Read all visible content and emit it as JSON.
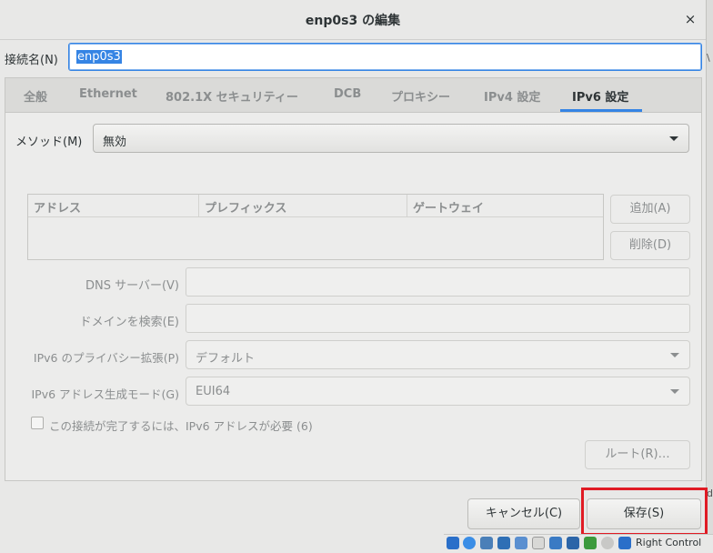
{
  "window": {
    "title": "enp0s3 の編集",
    "close_glyph": "×"
  },
  "connection_name": {
    "label": "接続名(N)",
    "value": "enp0s3"
  },
  "tabs": [
    "全般",
    "Ethernet",
    "802.1X セキュリティー",
    "DCB",
    "プロキシー",
    "IPv4 設定",
    "IPv6 設定"
  ],
  "active_tab": "IPv6 設定",
  "method": {
    "label": "メソッド(M)",
    "value": "無効"
  },
  "address_table": {
    "headers": [
      "アドレス",
      "プレフィックス",
      "ゲートウェイ"
    ],
    "rows": []
  },
  "buttons": {
    "add": "追加(A)",
    "delete": "削除(D)",
    "routes": "ルート(R)…",
    "cancel": "キャンセル(C)",
    "save": "保存(S)"
  },
  "dns": {
    "label": "DNS サーバー(V)",
    "value": ""
  },
  "search_domains": {
    "label": "ドメインを検索(E)",
    "value": ""
  },
  "privacy": {
    "label": "IPv6 のプライバシー拡張(P)",
    "value": "デフォルト"
  },
  "addr_gen": {
    "label": "IPv6 アドレス生成モード(G)",
    "value": "EUI64"
  },
  "require_ipv6": {
    "label": "この接続が完了するには、IPv6 アドレスが必要 (6)",
    "checked": false
  },
  "taskbar": {
    "right_control": "Right Control"
  },
  "edge_text": {
    "e1": "\\",
    "e2": "d"
  },
  "colors": {
    "accent": "#3584e4",
    "highlight": "#e01b24"
  }
}
